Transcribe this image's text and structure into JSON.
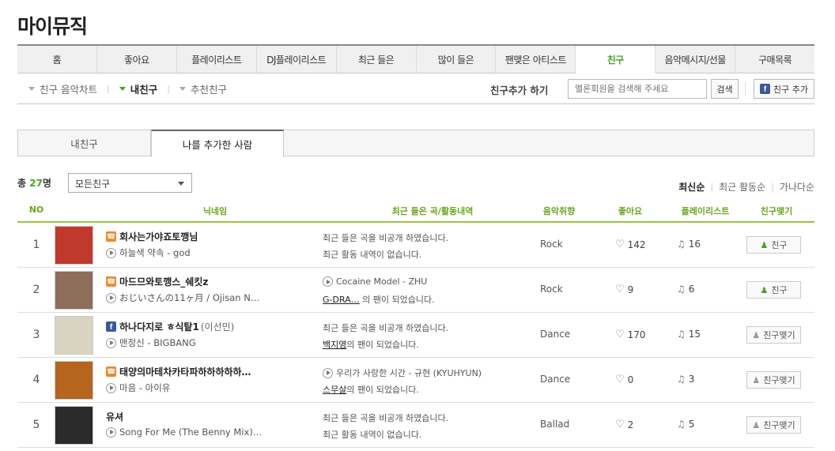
{
  "page_title": "마이뮤직",
  "main_tabs": [
    {
      "label": "홈",
      "active": false
    },
    {
      "label": "좋아요",
      "active": false
    },
    {
      "label": "플레이리스트",
      "active": false
    },
    {
      "label": "DJ플레이리스트",
      "active": false
    },
    {
      "label": "최근 들은",
      "active": false
    },
    {
      "label": "많이 들은",
      "active": false
    },
    {
      "label": "팬맺은 아티스트",
      "active": false
    },
    {
      "label": "친구",
      "active": true
    },
    {
      "label": "음악메시지/선물",
      "active": false
    },
    {
      "label": "구매목록",
      "active": false
    }
  ],
  "sub_nav": {
    "links": [
      {
        "label": "친구 음악차트",
        "active": false
      },
      {
        "label": "내친구",
        "active": true
      },
      {
        "label": "추천친구",
        "active": false
      }
    ],
    "friend_add_label": "친구추가 하기",
    "search_placeholder": "멜론회원을 검색해 주세요",
    "search_button": "검색",
    "facebook_button": "친구 추가"
  },
  "sub_tabs": [
    {
      "label": "내친구",
      "active": false
    },
    {
      "label": "나를 추가한 사람",
      "active": true
    }
  ],
  "total": {
    "prefix": "총 ",
    "count": "27",
    "suffix": "명"
  },
  "filter_select": "모든친구",
  "sort_options": [
    {
      "label": "최신순",
      "active": true
    },
    {
      "label": "최근 활동순",
      "active": false
    },
    {
      "label": "가나다순",
      "active": false
    }
  ],
  "columns": [
    "NO",
    "닉네임",
    "최근 들은 곡/활동내역",
    "음악취향",
    "좋아요",
    "플레이리스트",
    "친구맺기"
  ],
  "rows": [
    {
      "no": "1",
      "thumb_color": "#c0392b",
      "source": "melon",
      "nickname": "회사는가야죠토깽님",
      "nickname_sub": "",
      "song": "하늘색 약속 - god",
      "act1": "최근 들은 곡을 비공개 하였습니다.",
      "act1_play": false,
      "act2_link": "",
      "act2_text": "최근 활동 내역이 없습니다.",
      "genre": "Rock",
      "likes": "142",
      "playlists": "16",
      "friend_label": "친구",
      "is_friend": true
    },
    {
      "no": "2",
      "thumb_color": "#8d6e5a",
      "source": "melon",
      "nickname": "마드므와토깽스_쉐킷z",
      "nickname_sub": "",
      "song": "おじいさんの11ヶ月 / Ojisan N…",
      "act1": "Cocaine Model - ZHU",
      "act1_play": true,
      "act2_link": "G-DRA…",
      "act2_text": " 의 팬이 되었습니다.",
      "genre": "Rock",
      "likes": "9",
      "playlists": "6",
      "friend_label": "친구",
      "is_friend": true
    },
    {
      "no": "3",
      "thumb_color": "#d8d4c0",
      "source": "facebook",
      "nickname": "하나다지로 ㅎ식탙1",
      "nickname_sub": "(이선민)",
      "song": "맨정신 - BIGBANG",
      "act1": "최근 들은 곡을 비공개 하였습니다.",
      "act1_play": false,
      "act2_link": "백지영",
      "act2_text": "의 팬이 되었습니다.",
      "genre": "Dance",
      "likes": "170",
      "playlists": "15",
      "friend_label": "친구맺기",
      "is_friend": false
    },
    {
      "no": "4",
      "thumb_color": "#b5651d",
      "source": "melon",
      "nickname": "태양의마테차카타파하하하하하…",
      "nickname_sub": "",
      "song": "마음 - 아이유",
      "act1": "우리가 사랑한 시간 - 규현 (KYUHYUN)",
      "act1_play": true,
      "act2_link": "스무살",
      "act2_text": "의 팬이 되었습니다.",
      "genre": "Dance",
      "likes": "0",
      "playlists": "3",
      "friend_label": "친구맺기",
      "is_friend": false
    },
    {
      "no": "5",
      "thumb_color": "#2b2b2b",
      "source": "none",
      "nickname": "유셔",
      "nickname_sub": "",
      "song": "Song For Me (The Benny Mix)…",
      "act1": "최근 들은 곡을 비공개 하였습니다.",
      "act1_play": false,
      "act2_link": "",
      "act2_text": "최근 활동 내역이 없습니다.",
      "genre": "Ballad",
      "likes": "2",
      "playlists": "5",
      "friend_label": "친구맺기",
      "is_friend": false
    }
  ]
}
